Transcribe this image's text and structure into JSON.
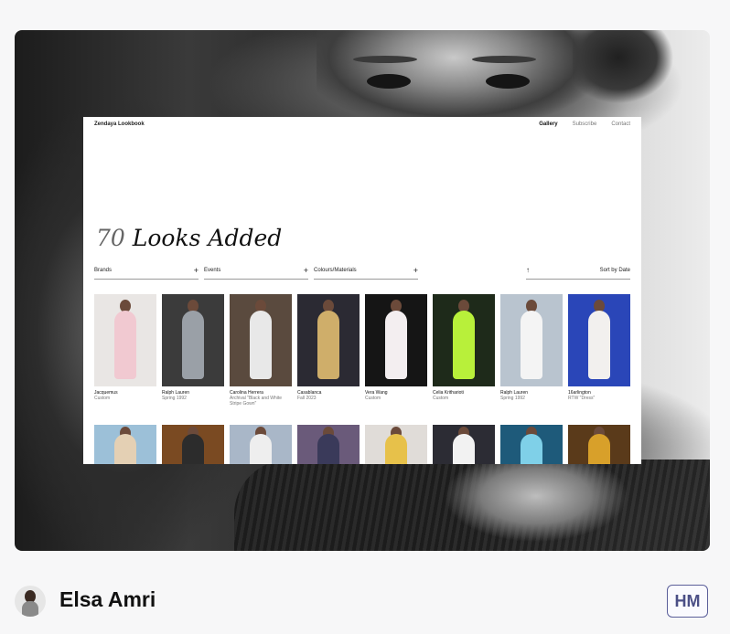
{
  "preview": {
    "site": {
      "brand": "Zendaya Lookbook",
      "nav": [
        {
          "label": "Gallery",
          "active": true
        },
        {
          "label": "Subscribe",
          "active": false
        },
        {
          "label": "Contact",
          "active": false
        }
      ],
      "headline_number": "70",
      "headline_text": "Looks Added",
      "filters": [
        {
          "label": "Brands"
        },
        {
          "label": "Events"
        },
        {
          "label": "Colours/Materials"
        }
      ],
      "sort_label": "Sort by Date",
      "looks": [
        {
          "brand": "Jacquemus",
          "detail": "Custom",
          "bg": "#e9e6e4",
          "outfit": "#f1c9d1"
        },
        {
          "brand": "Ralph Lauren",
          "detail": "Spring 1992",
          "bg": "#3b3b3b",
          "outfit": "#9aa0a7"
        },
        {
          "brand": "Carolina Herrera",
          "detail": "Archival \"Black and White Stripe Gown\"",
          "bg": "#5a4a3e",
          "outfit": "#e8e8e8"
        },
        {
          "brand": "Casablanca",
          "detail": "Fall 2023",
          "bg": "#2b2a33",
          "outfit": "#cfae6a"
        },
        {
          "brand": "Vera Wang",
          "detail": "Custom",
          "bg": "#151515",
          "outfit": "#f3eef0"
        },
        {
          "brand": "Celia Kritharioti",
          "detail": "Custom",
          "bg": "#1e2a1a",
          "outfit": "#b8f03a"
        },
        {
          "brand": "Ralph Lauren",
          "detail": "Spring 1992",
          "bg": "#b9c4cf",
          "outfit": "#f4f4f4"
        },
        {
          "brand": "16arlington",
          "detail": "RTW \"Dress\"",
          "bg": "#2a46b8",
          "outfit": "#f2f0ee"
        }
      ],
      "looks_row2": [
        {
          "bg": "#9cc0d8",
          "outfit": "#e4d0b4"
        },
        {
          "bg": "#7a4a22",
          "outfit": "#2c2c2c"
        },
        {
          "bg": "#a9b7c8",
          "outfit": "#eeeeee"
        },
        {
          "bg": "#6a5a7a",
          "outfit": "#3a3a5a"
        },
        {
          "bg": "#e0dcd8",
          "outfit": "#e7c14a"
        },
        {
          "bg": "#2c2c34",
          "outfit": "#f2f2f2"
        },
        {
          "bg": "#1e5a7a",
          "outfit": "#7fd0e8"
        },
        {
          "bg": "#5a3a1a",
          "outfit": "#d8a02a"
        }
      ]
    }
  },
  "author": {
    "name": "Elsa Amri",
    "badge": "HM"
  }
}
